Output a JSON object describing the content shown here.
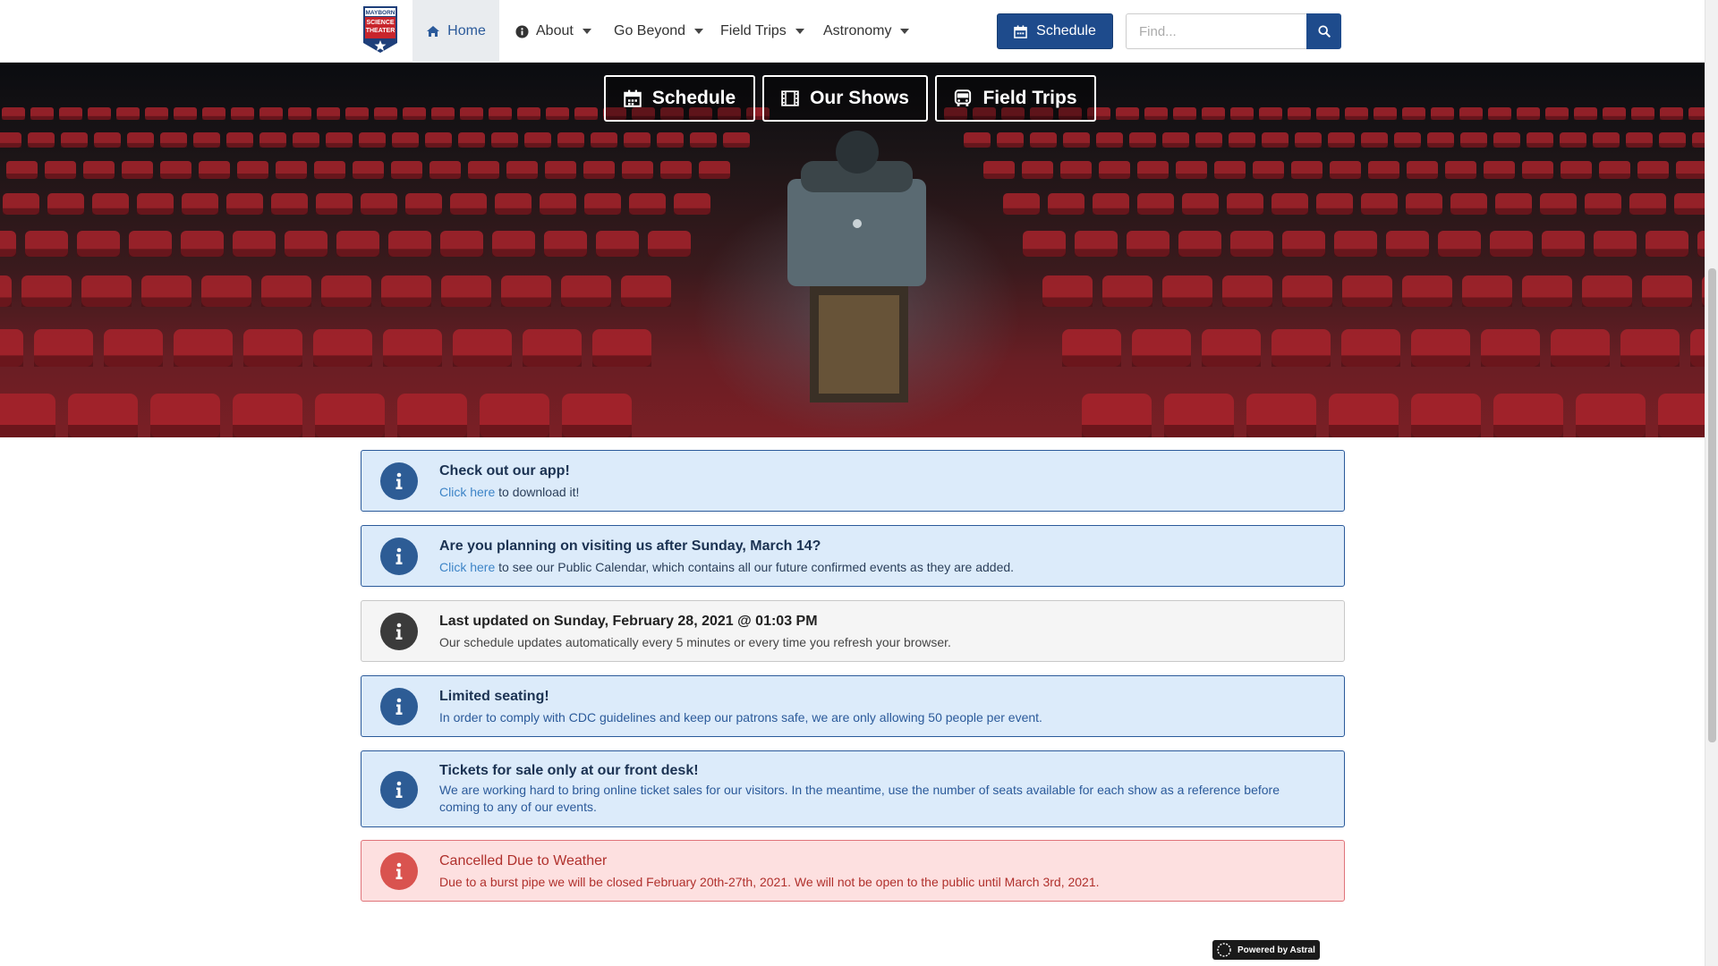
{
  "nav": {
    "logo_text": [
      "MAYBORN",
      "SCIENCE",
      "THEATER"
    ],
    "items": [
      {
        "label": "Home",
        "icon": "home-icon"
      },
      {
        "label": "About",
        "icon": "info-circle-icon"
      },
      {
        "label": "Go Beyond"
      },
      {
        "label": "Field Trips"
      },
      {
        "label": "Astronomy"
      }
    ],
    "schedule_button": "Schedule",
    "search_placeholder": "Find..."
  },
  "hero": {
    "buttons": [
      {
        "label": "Schedule",
        "icon": "calendar-icon"
      },
      {
        "label": "Our Shows",
        "icon": "film-icon"
      },
      {
        "label": "Field Trips",
        "icon": "bus-icon"
      }
    ]
  },
  "alerts": [
    {
      "title": "Check out our app!",
      "link": "Click here",
      "text": " to download it!"
    },
    {
      "title": "Are you planning on visiting us after Sunday, March 14?",
      "link": "Click here",
      "text": " to see our Public Calendar, which contains all our future confirmed events as they are added."
    },
    {
      "title": "Last updated on Sunday, February 28, 2021 @ 01:03 PM",
      "text": "Our schedule updates automatically every 5 minutes or every time you refresh your browser."
    },
    {
      "title": "Limited seating!",
      "text": "In order to comply with CDC guidelines and keep our patrons safe, we are only allowing 50 people per event."
    },
    {
      "title": "Tickets for sale only at our front desk!",
      "text": "We are working hard to bring online ticket sales for our visitors. In the meantime, use the number of seats available for each show as a reference before coming to any of our events."
    },
    {
      "title": "Cancelled Due to Weather",
      "text": "Due to a burst pipe we will be closed February 20th-27th, 2021. We will not be open to the public until March 3rd, 2021."
    }
  ],
  "footer": {
    "powered_by": "Powered by Astral"
  },
  "colors": {
    "primary": "#1e4b8c",
    "info_bg": "#dcebfa",
    "danger": "#d9534f",
    "seat_red": "#a8232c"
  }
}
